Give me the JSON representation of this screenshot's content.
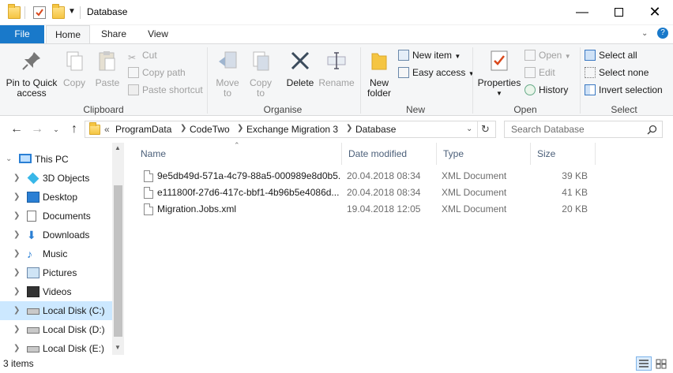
{
  "window": {
    "title": "Database",
    "controls": [
      "minimize",
      "maximize",
      "close"
    ]
  },
  "ribbon_tabs": [
    {
      "label": "File"
    },
    {
      "label": "Home"
    },
    {
      "label": "Share"
    },
    {
      "label": "View"
    }
  ],
  "ribbon": {
    "clipboard": {
      "group_label": "Clipboard",
      "pin_label": "Pin to Quick access",
      "copy_label": "Copy",
      "paste_label": "Paste",
      "cut_label": "Cut",
      "copy_path_label": "Copy path",
      "paste_shortcut_label": "Paste shortcut"
    },
    "organise": {
      "group_label": "Organise",
      "move_to_label": "Move to",
      "copy_to_label": "Copy to",
      "delete_label": "Delete",
      "rename_label": "Rename"
    },
    "new": {
      "group_label": "New",
      "new_folder_label": "New folder",
      "new_item_label": "New item",
      "easy_access_label": "Easy access"
    },
    "open": {
      "group_label": "Open",
      "properties_label": "Properties",
      "open_label": "Open",
      "edit_label": "Edit",
      "history_label": "History"
    },
    "select": {
      "group_label": "Select",
      "select_all_label": "Select all",
      "select_none_label": "Select none",
      "invert_selection_label": "Invert selection"
    }
  },
  "address": {
    "prefix": "«",
    "breadcrumbs": [
      "ProgramData",
      "CodeTwo",
      "Exchange Migration 3",
      "Database"
    ],
    "search_placeholder": "Search Database"
  },
  "nav_pane": {
    "items": [
      {
        "label": "This PC",
        "icon": "monitor-icon",
        "selected": false
      },
      {
        "label": "3D Objects",
        "icon": "cube-icon",
        "selected": false
      },
      {
        "label": "Desktop",
        "icon": "desktop-icon",
        "selected": false
      },
      {
        "label": "Documents",
        "icon": "documents-icon",
        "selected": false
      },
      {
        "label": "Downloads",
        "icon": "download-icon",
        "selected": false
      },
      {
        "label": "Music",
        "icon": "music-icon",
        "selected": false
      },
      {
        "label": "Pictures",
        "icon": "pictures-icon",
        "selected": false
      },
      {
        "label": "Videos",
        "icon": "videos-icon",
        "selected": false
      },
      {
        "label": "Local Disk (C:)",
        "icon": "drive-icon",
        "selected": true
      },
      {
        "label": "Local Disk (D:)",
        "icon": "drive-icon",
        "selected": false
      },
      {
        "label": "Local Disk (E:)",
        "icon": "drive-icon",
        "selected": false
      }
    ]
  },
  "file_list": {
    "columns": [
      "Name",
      "Date modified",
      "Type",
      "Size"
    ],
    "files": [
      {
        "name": "9e5db49d-571a-4c79-88a5-000989e8d0b5...",
        "date": "20.04.2018 08:34",
        "type": "XML Document",
        "size": "39 KB"
      },
      {
        "name": "e111800f-27d6-417c-bbf1-4b96b5e4086d...",
        "date": "20.04.2018 08:34",
        "type": "XML Document",
        "size": "41 KB"
      },
      {
        "name": "Migration.Jobs.xml",
        "date": "19.04.2018 12:05",
        "type": "XML Document",
        "size": "20 KB"
      }
    ]
  },
  "status_bar": {
    "item_count": "3 items"
  },
  "colors": {
    "file_tab": "#1979ca",
    "selection": "#cce8ff",
    "ribbon_bg": "#f5f6f7"
  }
}
